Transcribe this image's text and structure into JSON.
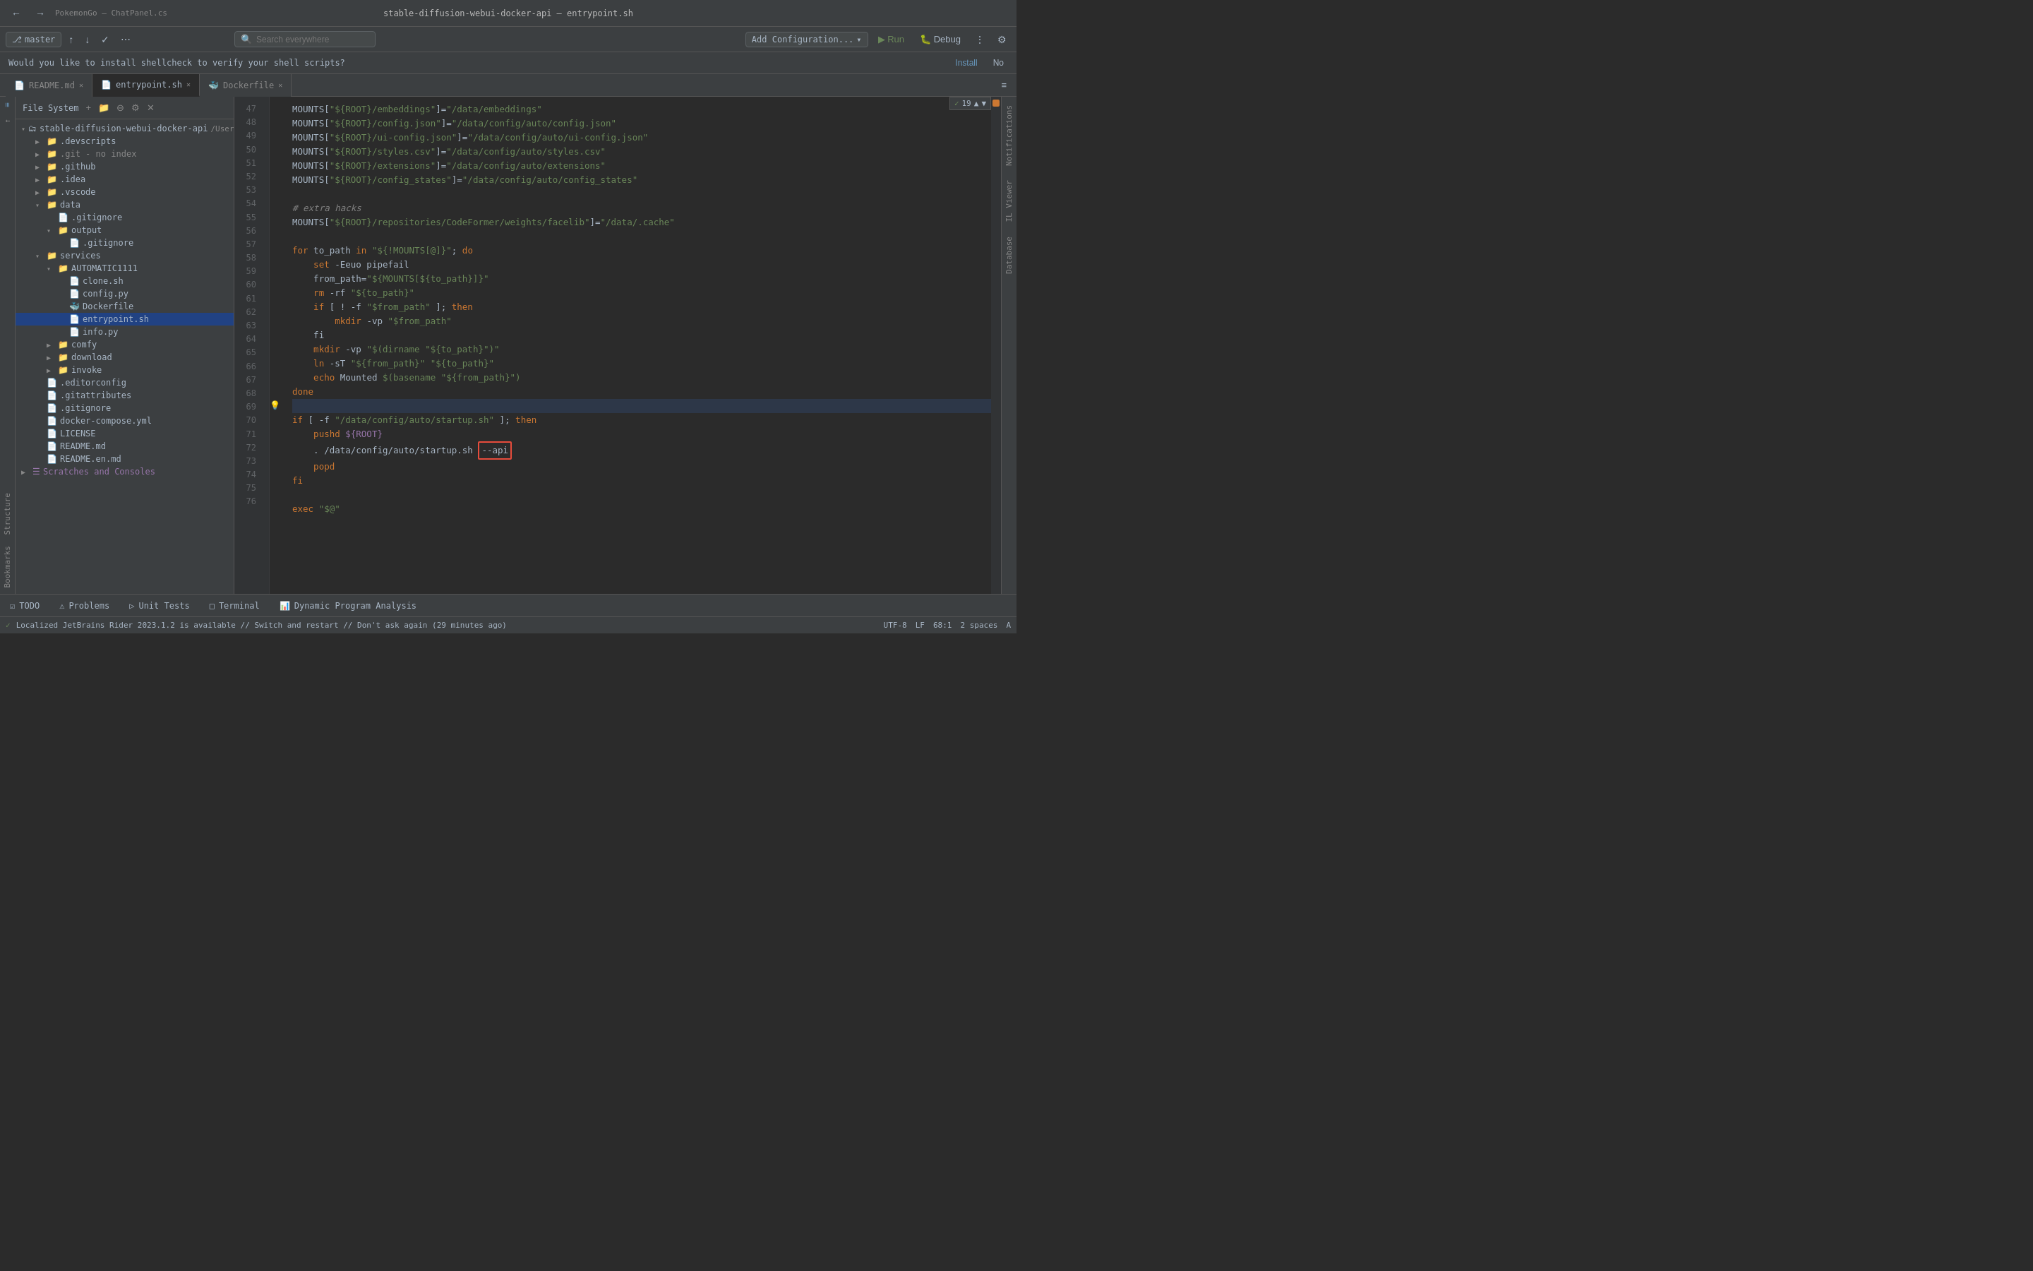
{
  "window": {
    "left_title": "PokemonGo – ChatPanel.cs",
    "right_title": "stable-diffusion-webui-docker-api – entrypoint.sh"
  },
  "toolbar": {
    "branch_label": "master",
    "search_placeholder": "Search everywhere",
    "config_label": "Add Configuration...",
    "run_label": "Run",
    "debug_label": "Debug"
  },
  "notification": {
    "message": "Would you like to install shellcheck to verify your shell scripts?",
    "install_label": "Install",
    "no_label": "No"
  },
  "tabs": [
    {
      "id": "readme",
      "label": "README.md",
      "icon": "📄",
      "active": false
    },
    {
      "id": "entrypoint",
      "label": "entrypoint.sh",
      "icon": "📄",
      "active": true
    },
    {
      "id": "dockerfile",
      "label": "Dockerfile",
      "icon": "🐳",
      "active": false
    }
  ],
  "sidebar": {
    "title": "File System",
    "root": "stable-diffusion-webui-docker-api",
    "root_path": "/User",
    "items": [
      {
        "id": "devscripts",
        "label": ".devscripts",
        "type": "folder",
        "indent": 1,
        "expanded": false
      },
      {
        "id": "git",
        "label": ".git - no index",
        "type": "folder",
        "indent": 1,
        "expanded": false
      },
      {
        "id": "github",
        "label": ".github",
        "type": "folder",
        "indent": 1,
        "expanded": false
      },
      {
        "id": "idea",
        "label": ".idea",
        "type": "folder",
        "indent": 1,
        "expanded": false
      },
      {
        "id": "vscode",
        "label": ".vscode",
        "type": "folder",
        "indent": 1,
        "expanded": false
      },
      {
        "id": "data",
        "label": "data",
        "type": "folder",
        "indent": 1,
        "expanded": true
      },
      {
        "id": "gitignore-data",
        "label": ".gitignore",
        "type": "file",
        "indent": 2,
        "fileType": "cfg"
      },
      {
        "id": "output",
        "label": "output",
        "type": "folder",
        "indent": 2,
        "expanded": true
      },
      {
        "id": "gitignore-output",
        "label": ".gitignore",
        "type": "file",
        "indent": 3,
        "fileType": "cfg"
      },
      {
        "id": "services",
        "label": "services",
        "type": "folder",
        "indent": 1,
        "expanded": true
      },
      {
        "id": "AUTOMATIC1111",
        "label": "AUTOMATIC1111",
        "type": "folder",
        "indent": 2,
        "expanded": true
      },
      {
        "id": "clone.sh",
        "label": "clone.sh",
        "type": "file",
        "indent": 3,
        "fileType": "sh"
      },
      {
        "id": "config.py",
        "label": "config.py",
        "type": "file",
        "indent": 3,
        "fileType": "py"
      },
      {
        "id": "Dockerfile",
        "label": "Dockerfile",
        "type": "file",
        "indent": 3,
        "fileType": "docker",
        "selected": false
      },
      {
        "id": "entrypoint.sh",
        "label": "entrypoint.sh",
        "type": "file",
        "indent": 3,
        "fileType": "sh",
        "selected": true
      },
      {
        "id": "info.py",
        "label": "info.py",
        "type": "file",
        "indent": 3,
        "fileType": "py"
      },
      {
        "id": "comfy",
        "label": "comfy",
        "type": "folder",
        "indent": 2,
        "expanded": false
      },
      {
        "id": "download",
        "label": "download",
        "type": "folder",
        "indent": 2,
        "expanded": false
      },
      {
        "id": "invoke",
        "label": "invoke",
        "type": "folder",
        "indent": 2,
        "expanded": false
      },
      {
        "id": "editorconfig",
        "label": ".editorconfig",
        "type": "file",
        "indent": 1,
        "fileType": "cfg"
      },
      {
        "id": "gitattributes",
        "label": ".gitattributes",
        "type": "file",
        "indent": 1,
        "fileType": "cfg"
      },
      {
        "id": "gitignore",
        "label": ".gitignore",
        "type": "file",
        "indent": 1,
        "fileType": "cfg"
      },
      {
        "id": "docker-compose.yml",
        "label": "docker-compose.yml",
        "type": "file",
        "indent": 1,
        "fileType": "yml"
      },
      {
        "id": "LICENSE",
        "label": "LICENSE",
        "type": "file",
        "indent": 1,
        "fileType": "cfg"
      },
      {
        "id": "README.md",
        "label": "README.md",
        "type": "file",
        "indent": 1,
        "fileType": "md"
      },
      {
        "id": "README.en.md",
        "label": "README.en.md",
        "type": "file",
        "indent": 1,
        "fileType": "md"
      },
      {
        "id": "scratches",
        "label": "Scratches and Consoles",
        "type": "special",
        "indent": 0
      }
    ]
  },
  "editor": {
    "file": "entrypoint.sh",
    "lines": [
      {
        "num": 47,
        "code": "MOUNTS[\"${ROOT}/embeddings\"]=\"/data/embeddings\"",
        "gutter": ""
      },
      {
        "num": 48,
        "code": "MOUNTS[\"${ROOT}/config.json\"]=\"/data/config/auto/config.json\"",
        "gutter": ""
      },
      {
        "num": 49,
        "code": "MOUNTS[\"${ROOT}/ui-config.json\"]=\"/data/config/auto/ui-config.json\"",
        "gutter": ""
      },
      {
        "num": 50,
        "code": "MOUNTS[\"${ROOT}/styles.csv\"]=\"/data/config/auto/styles.csv\"",
        "gutter": ""
      },
      {
        "num": 51,
        "code": "MOUNTS[\"${ROOT}/extensions\"]=\"/data/config/auto/extensions\"",
        "gutter": ""
      },
      {
        "num": 52,
        "code": "MOUNTS[\"${ROOT}/config_states\"]=\"/data/config/auto/config_states\"",
        "gutter": ""
      },
      {
        "num": 53,
        "code": "",
        "gutter": ""
      },
      {
        "num": 54,
        "code": "# extra hacks",
        "gutter": ""
      },
      {
        "num": 55,
        "code": "MOUNTS[\"${ROOT}/repositories/CodeFormer/weights/facelib\"]=\"/data/.cache\"",
        "gutter": ""
      },
      {
        "num": 56,
        "code": "",
        "gutter": ""
      },
      {
        "num": 57,
        "code": "for to_path in \"${!MOUNTS[@]}\"; do",
        "gutter": ""
      },
      {
        "num": 58,
        "code": "    set -Eeuo pipefail",
        "gutter": ""
      },
      {
        "num": 59,
        "code": "    from_path=\"${MOUNTS[${to_path}]}\"",
        "gutter": ""
      },
      {
        "num": 60,
        "code": "    rm -rf \"${to_path}\"",
        "gutter": ""
      },
      {
        "num": 61,
        "code": "    if [ ! -f \"$from_path\" ]; then",
        "gutter": ""
      },
      {
        "num": 62,
        "code": "        mkdir -vp \"$from_path\"",
        "gutter": ""
      },
      {
        "num": 63,
        "code": "    fi",
        "gutter": ""
      },
      {
        "num": 64,
        "code": "    mkdir -vp \"$(dirname \"${to_path}\")\"",
        "gutter": ""
      },
      {
        "num": 65,
        "code": "    ln -sT \"${from_path}\" \"${to_path}\"",
        "gutter": ""
      },
      {
        "num": 66,
        "code": "    echo Mounted $(basename \"${from_path}\")",
        "gutter": ""
      },
      {
        "num": 67,
        "code": "done",
        "gutter": ""
      },
      {
        "num": 68,
        "code": "",
        "gutter": "bulb"
      },
      {
        "num": 69,
        "code": "if [ -f \"/data/config/auto/startup.sh\" ]; then",
        "gutter": ""
      },
      {
        "num": 70,
        "code": "    pushd ${ROOT}",
        "gutter": ""
      },
      {
        "num": 71,
        "code": "    . /data/config/auto/startup.sh --api",
        "gutter": "",
        "highlight": "--api"
      },
      {
        "num": 72,
        "code": "    popd",
        "gutter": ""
      },
      {
        "num": 73,
        "code": "fi",
        "gutter": ""
      },
      {
        "num": 74,
        "code": "",
        "gutter": ""
      },
      {
        "num": 75,
        "code": "exec \"$@\"",
        "gutter": ""
      },
      {
        "num": 76,
        "code": "",
        "gutter": ""
      }
    ]
  },
  "status_bar": {
    "todo": "TODO",
    "problems": "Problems",
    "unit_tests": "Unit Tests",
    "terminal": "Terminal",
    "dynamic_analysis": "Dynamic Program Analysis",
    "update_message": "Localized JetBrains Rider 2023.1.2 is available // Switch and restart // Don't ask again (29 minutes ago)",
    "position": "68:1",
    "line_ending": "LF",
    "encoding": "UTF-8",
    "indent": "2 spaces",
    "warnings_count": "19"
  },
  "right_panels": [
    {
      "id": "notifications",
      "label": "Notifications"
    },
    {
      "id": "il-viewer",
      "label": "IL Viewer"
    },
    {
      "id": "database",
      "label": "Database"
    }
  ],
  "left_panels": [
    {
      "id": "structure",
      "label": "Structure"
    },
    {
      "id": "bookmarks",
      "label": "Bookmarks"
    }
  ]
}
